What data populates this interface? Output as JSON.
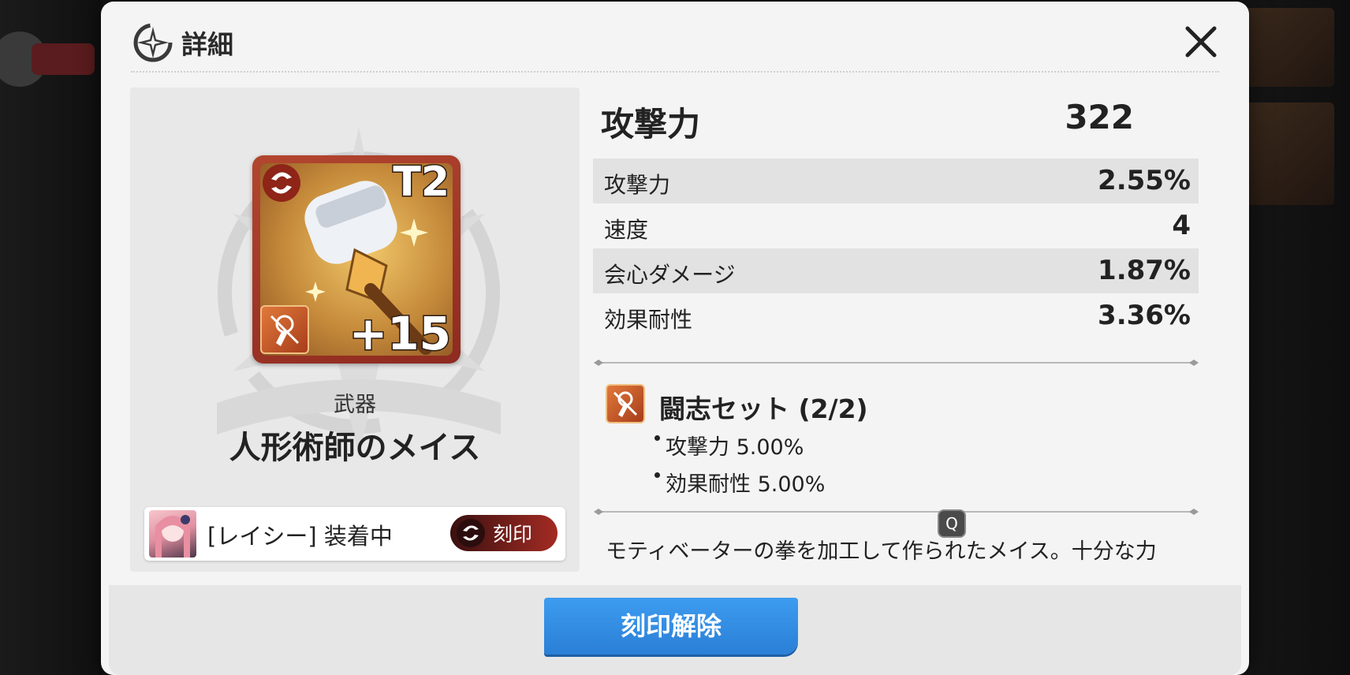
{
  "modal": {
    "title": "詳細",
    "close_icon": "close-icon"
  },
  "item": {
    "tier": "T2",
    "enhance_level": "+15",
    "type": "武器",
    "name": "人形術師のメイス",
    "frame_color": "#b3462f"
  },
  "equipped": {
    "text": "[レイシー] 装着中",
    "engrave_button_label": "刻印"
  },
  "main_stat": {
    "name": "攻撃力",
    "value": "322"
  },
  "sub_stats": [
    {
      "name": "攻撃力",
      "value": "2.55%"
    },
    {
      "name": "速度",
      "value": "4"
    },
    {
      "name": "会心ダメージ",
      "value": "1.87%"
    },
    {
      "name": "効果耐性",
      "value": "3.36%"
    }
  ],
  "set": {
    "title": "闘志セット (2/2)",
    "bonuses": [
      "攻撃力 5.00%",
      "効果耐性 5.00%"
    ]
  },
  "description": "モティベーターの拳を加工して作られたメイス。十分な力",
  "overlay_badge": "Q",
  "footer": {
    "unengrave_label": "刻印解除",
    "button_color": "#2a7fd6"
  }
}
